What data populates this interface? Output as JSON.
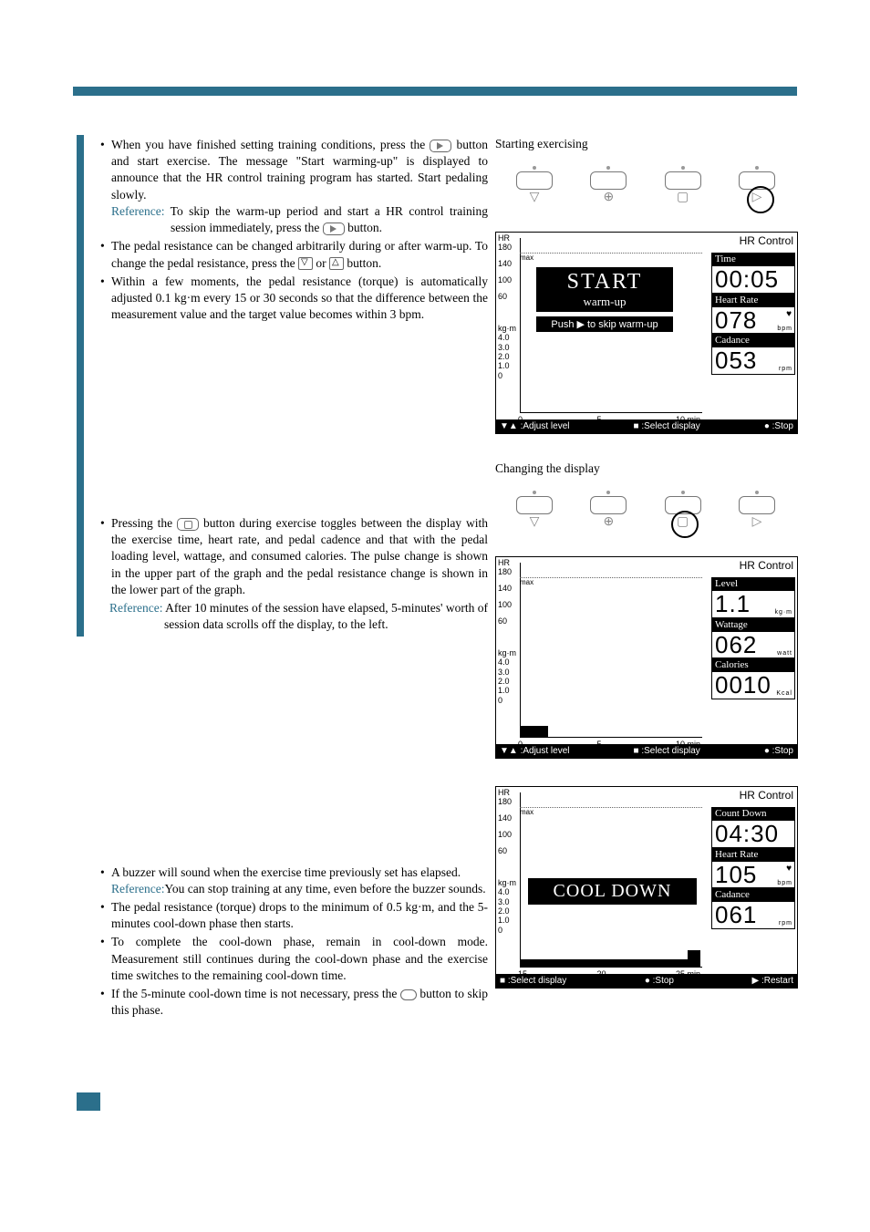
{
  "captions": {
    "starting": "Starting exercising",
    "changing": "Changing the display"
  },
  "section1": {
    "b1a": "When you have finished setting training conditions, press the ",
    "b1b": " button and start exercise. The message \"Start warming-up\" is displayed to announce that the HR control training program has started. Start pedaling slowly.",
    "ref1a": "Reference:",
    "ref1b": " To skip the warm-up period and start a HR control training session immediately, press the ",
    "ref1c": " button.",
    "b2a": "The pedal resistance can be changed arbitrarily during or after warm-up. To change the pedal resistance, press the ",
    "b2b": " or ",
    "b2c": " button.",
    "b3": "Within a few moments, the pedal resistance (torque) is automatically adjusted   0.1 kg·m every 15 or 30 seconds so that the difference between the measurement value and the target value becomes within   3 bpm."
  },
  "section2": {
    "b1a": "Pressing the ",
    "b1b": " button during exercise toggles between the display with the exercise time, heart rate, and pedal cadence and that with the pedal loading level, wattage, and consumed calories. The pulse change is shown in the upper part of the graph and the pedal resistance change is shown in the lower part of the graph.",
    "ref1a": "Reference:",
    "ref1b": " After 10 minutes of the session have elapsed, 5-minutes' worth of session data scrolls off the display, to the left."
  },
  "section3": {
    "b1": "A buzzer will sound when the exercise time previously set has elapsed.",
    "ref1a": "Reference:",
    "ref1b": "You can stop training at any time, even before the buzzer sounds.",
    "b2": "The pedal resistance (torque) drops to the minimum of 0.5 kg·m, and the 5-minutes cool-down phase then starts.",
    "b3": "To complete the cool-down phase, remain in cool-down mode. Measurement still continues during the cool-down phase and the exercise time switches to the remaining cool-down time.",
    "b4a": "If the 5-minute cool-down time is not necessary, press the ",
    "b4b": " button to skip this phase."
  },
  "screen1": {
    "mode": "HR Control",
    "banner_big": "START",
    "banner_sm": "warm-up",
    "push": "Push ▶ to skip warm-up",
    "time_label": "Time",
    "time_val": "00:05",
    "hr_label": "Heart Rate",
    "hr_val": "078",
    "hr_unit": "bpm",
    "cad_label": "Cadance",
    "cad_val": "053",
    "cad_unit": "rpm",
    "foot_l": "▼▲ :Adjust level",
    "foot_m": "■ :Select display",
    "foot_r": "● :Stop",
    "y_hr": [
      "HR",
      "180",
      "140",
      "100",
      "60"
    ],
    "y_kg": [
      "kg·m",
      "4.0",
      "3.0",
      "2.0",
      "1.0",
      "0"
    ],
    "x": [
      "0",
      "5",
      "10 min"
    ],
    "max": "max"
  },
  "screen2": {
    "mode": "HR Control",
    "level_label": "Level",
    "level_val": "1.1",
    "level_unit": "kg·m",
    "watt_label": "Wattage",
    "watt_val": "062",
    "watt_unit": "watt",
    "cal_label": "Calories",
    "cal_val": "0010",
    "cal_unit": "Kcal",
    "foot_l": "▼▲ :Adjust level",
    "foot_m": "■ :Select display",
    "foot_r": "● :Stop",
    "y_hr": [
      "HR",
      "180",
      "140",
      "100",
      "60"
    ],
    "y_kg": [
      "kg·m",
      "4.0",
      "3.0",
      "2.0",
      "1.0",
      "0"
    ],
    "x": [
      "0",
      "5",
      "10 min"
    ],
    "max": "max"
  },
  "screen3": {
    "mode": "HR Control",
    "banner": "COOL DOWN",
    "cd_label": "Count Down",
    "cd_val": "04:30",
    "hr_label": "Heart Rate",
    "hr_val": "105",
    "hr_unit": "bpm",
    "cad_label": "Cadance",
    "cad_val": "061",
    "cad_unit": "rpm",
    "foot_l": "■ :Select display",
    "foot_m": "● :Stop",
    "foot_r": "▶ :Restart",
    "y_hr": [
      "HR",
      "180",
      "140",
      "100",
      "60"
    ],
    "y_kg": [
      "kg·m",
      "4.0",
      "3.0",
      "2.0",
      "1.0",
      "0"
    ],
    "x": [
      "15",
      "20",
      "25 min"
    ],
    "max": "max"
  }
}
